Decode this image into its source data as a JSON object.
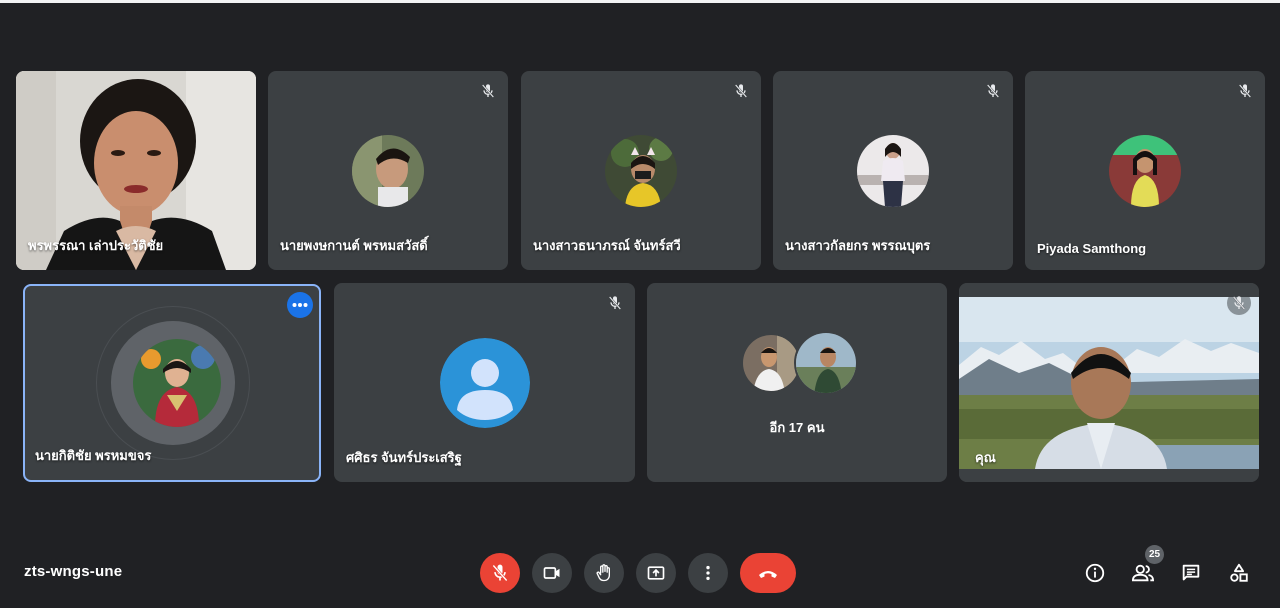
{
  "meeting": {
    "code": "zts-wngs-une",
    "participants_count": "25"
  },
  "tiles": {
    "t1": {
      "name": "พรพรรณา เล่าประวัติชัย",
      "video": true
    },
    "t2": {
      "name": "นายพงษกานต์ พรหมสวัสดิ์",
      "muted": true
    },
    "t3": {
      "name": "นางสาวธนาภรณ์ จันทร์สวี",
      "muted": true
    },
    "t4": {
      "name": "นางสาวกัลยกร พรรณบุตร",
      "muted": true
    },
    "t5": {
      "name": "Piyada Samthong",
      "muted": true
    },
    "t6": {
      "name": "นายกิติชัย พรหมขจร",
      "speaking": true
    },
    "t7": {
      "name": "ศศิธร จันทร์ประเสริฐ",
      "muted": true
    },
    "t8": {
      "more_label": "อีก 17 คน"
    },
    "t9": {
      "name": "คุณ",
      "muted": true,
      "video": true
    }
  },
  "controls": {
    "mic": "mic-off-icon",
    "camera": "video-camera-icon",
    "hand": "raise-hand-icon",
    "present": "present-screen-icon",
    "more": "more-vert-icon",
    "leave": "hang-up-icon"
  },
  "right_controls": [
    "info-icon",
    "people-icon",
    "chat-icon",
    "activities-icon"
  ],
  "colors": {
    "background": "#202124",
    "tile": "#3c4043",
    "accent": "#1a73e8",
    "danger": "#ea4335",
    "selected_border": "#8ab4f8"
  }
}
